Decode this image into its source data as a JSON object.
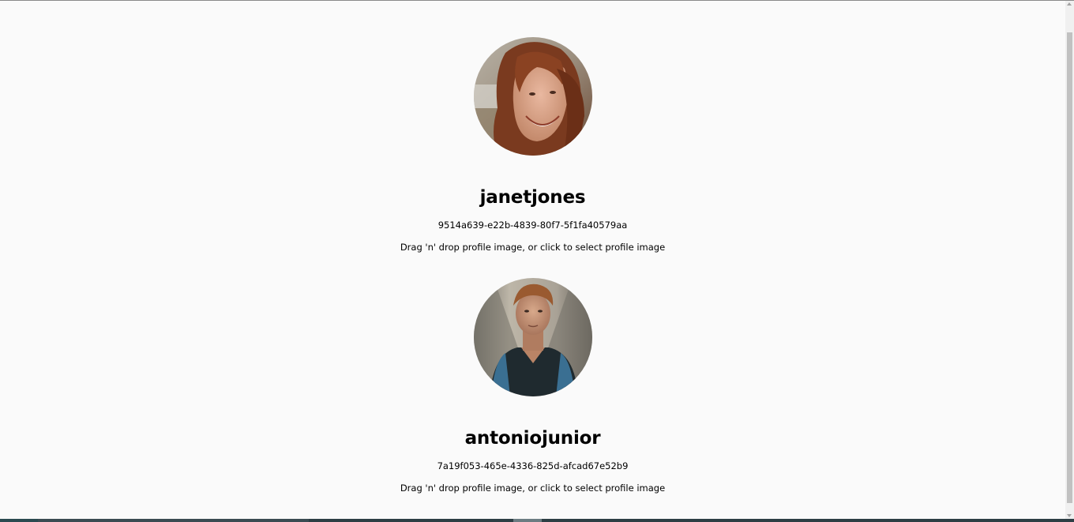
{
  "profiles": [
    {
      "username": "janetjones",
      "id": "9514a639-e22b-4839-80f7-5f1fa40579aa",
      "dropzone_text": "Drag 'n' drop profile image, or click to select profile image"
    },
    {
      "username": "antoniojunior",
      "id": "7a19f053-465e-4336-825d-afcad67e52b9",
      "dropzone_text": "Drag 'n' drop profile image, or click to select profile image"
    }
  ],
  "colors": {
    "background": "#fafafa",
    "text": "#000000",
    "scrollbar_track": "#f0f0f0",
    "scrollbar_thumb": "#c1c1c1"
  }
}
